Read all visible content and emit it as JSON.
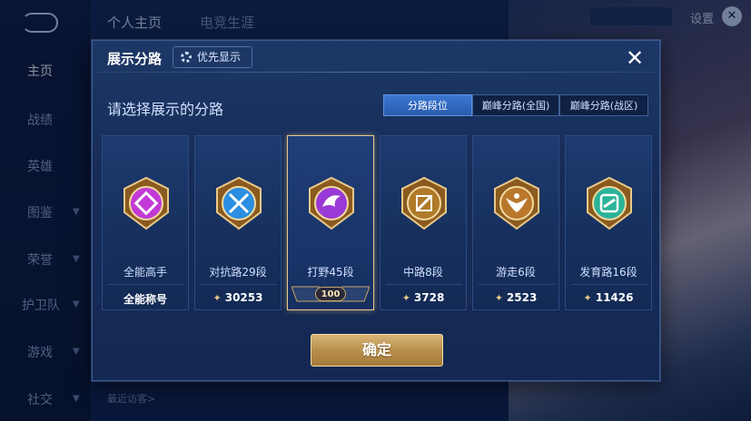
{
  "background": {
    "top_tabs": [
      "个人主页",
      "电竞生涯"
    ],
    "settings_label": "设置",
    "sidebar_items": [
      "主页",
      "战绩",
      "英雄",
      "图鉴",
      "荣誉",
      "护卫队",
      "游戏",
      "社交"
    ],
    "visitor_label": "最近访客>"
  },
  "modal": {
    "title": "展示分路",
    "priority_label": "优先显示",
    "subtitle": "请选择展示的分路",
    "segments": [
      {
        "label": "分路段位",
        "active": true
      },
      {
        "label": "巅峰分路(全国)",
        "active": false
      },
      {
        "label": "巅峰分路(战区)",
        "active": false
      }
    ],
    "cards": [
      {
        "name": "全能高手",
        "value": "全能称号",
        "icon": "all-rounder-badge-icon",
        "accent": "#c23ad6",
        "show_token": false,
        "selected": false
      },
      {
        "name": "对抗路29段",
        "value": "30253",
        "icon": "clash-lane-badge-icon",
        "accent": "#2a8fe0",
        "show_token": true,
        "selected": false
      },
      {
        "name": "打野45段",
        "value": "100",
        "icon": "jungle-badge-icon",
        "accent": "#9a3ad6",
        "show_token": false,
        "selected": true
      },
      {
        "name": "中路8段",
        "value": "3728",
        "icon": "mid-lane-badge-icon",
        "accent": "#b07a2a",
        "show_token": true,
        "selected": false
      },
      {
        "name": "游走6段",
        "value": "2523",
        "icon": "roam-badge-icon",
        "accent": "#b9772c",
        "show_token": true,
        "selected": false
      },
      {
        "name": "发育路16段",
        "value": "11426",
        "icon": "farm-lane-badge-icon",
        "accent": "#2bb39a",
        "show_token": true,
        "selected": false
      }
    ],
    "confirm_label": "确定"
  },
  "colors": {
    "gold": "#e9c98a",
    "active_tab": "#3a78d0"
  }
}
